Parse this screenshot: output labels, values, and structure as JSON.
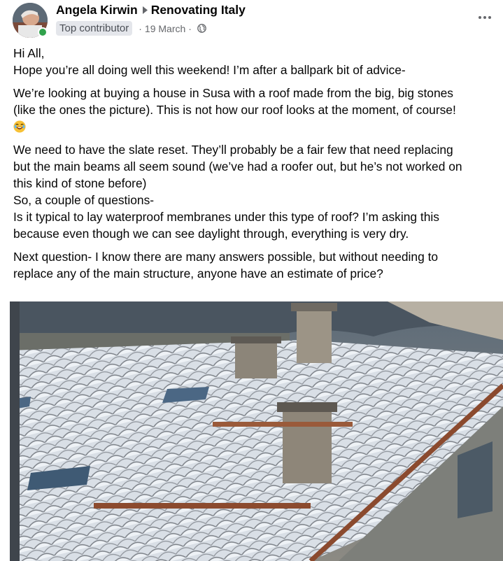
{
  "post": {
    "author": "Angela Kirwin",
    "group": "Renovating Italy",
    "badge": "Top contributor",
    "date": "19 March",
    "separator": "·",
    "audience_icon": "globe-icon",
    "more_icon": "more-options-icon"
  },
  "content": {
    "greeting": "Hi All,",
    "intro": "Hope you’re all doing well this weekend! I’m after a ballpark bit of advice-",
    "para1": [
      "We’re looking at buying a house in Susa with a roof made from the big, big stones",
      "(like the ones the picture). This is not how our roof looks at the moment, of course!"
    ],
    "emoji": "😂",
    "para2": [
      "We need to have the slate reset. They’ll probably be a fair few that need replacing",
      "but the main beams all seem sound (we’ve had a roofer out, but he’s not worked on",
      "this kind of stone before)",
      "So, a couple of questions-",
      "Is it typical to lay waterproof membranes under this type of roof? I’m asking this",
      "because even though we can see daylight through, everything is very dry."
    ],
    "para3": [
      "Next question- I know there are many answers possible, but without needing to",
      "replace any of the main structure, anyone have an estimate of price?"
    ]
  },
  "colors": {
    "text": "#050505",
    "secondary": "#65676b",
    "badge_bg": "#e4e6eb",
    "online": "#31a24c"
  }
}
